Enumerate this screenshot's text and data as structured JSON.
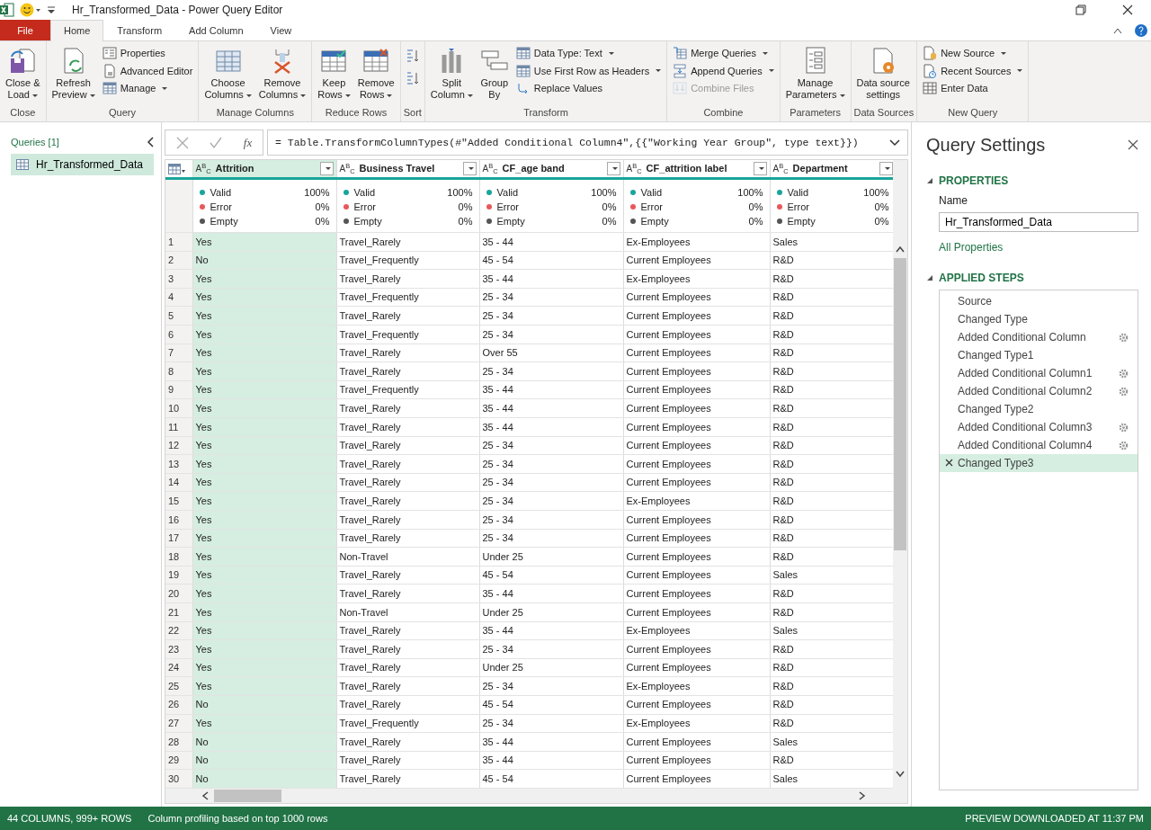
{
  "window": {
    "title": "Hr_Transformed_Data - Power Query Editor"
  },
  "tabs": [
    {
      "label": "File",
      "kind": "file",
      "selected": false
    },
    {
      "label": "Home",
      "kind": "tab",
      "selected": true
    },
    {
      "label": "Transform",
      "kind": "tab",
      "selected": false
    },
    {
      "label": "Add Column",
      "kind": "tab",
      "selected": false
    },
    {
      "label": "View",
      "kind": "tab",
      "selected": false
    }
  ],
  "ribbon": [
    {
      "label": "Close",
      "items": [
        {
          "kind": "large",
          "label": "Close &\nLoad",
          "dropdown": true,
          "disabled": false
        }
      ]
    },
    {
      "label": "Query",
      "items": [
        {
          "kind": "large",
          "label": "Refresh\nPreview",
          "dropdown": true,
          "disabled": false
        },
        {
          "kind": "small",
          "label": "Properties",
          "dropdown": false,
          "disabled": false
        },
        {
          "kind": "small",
          "label": "Advanced Editor",
          "dropdown": false,
          "disabled": false
        },
        {
          "kind": "small",
          "label": "Manage",
          "dropdown": true,
          "disabled": false
        }
      ]
    },
    {
      "label": "Manage Columns",
      "items": [
        {
          "kind": "large",
          "label": "Choose\nColumns",
          "dropdown": true,
          "disabled": false
        },
        {
          "kind": "large",
          "label": "Remove\nColumns",
          "dropdown": true,
          "disabled": false
        }
      ]
    },
    {
      "label": "Reduce Rows",
      "items": [
        {
          "kind": "large",
          "label": "Keep\nRows",
          "dropdown": true,
          "disabled": false
        },
        {
          "kind": "large",
          "label": "Remove\nRows",
          "dropdown": true,
          "disabled": false
        }
      ]
    },
    {
      "label": "Sort",
      "items": [
        {
          "kind": "icon",
          "dropdown": false,
          "disabled": false
        },
        {
          "kind": "icon",
          "dropdown": false,
          "disabled": false
        }
      ]
    },
    {
      "label": "Transform",
      "items": [
        {
          "kind": "large",
          "label": "Split\nColumn",
          "dropdown": true,
          "disabled": false
        },
        {
          "kind": "large",
          "label": "Group\nBy",
          "dropdown": false,
          "disabled": false
        },
        {
          "kind": "small",
          "label": "Data Type: Text",
          "dropdown": true,
          "disabled": false
        },
        {
          "kind": "small",
          "label": "Use First Row as Headers",
          "dropdown": true,
          "disabled": false
        },
        {
          "kind": "small",
          "label": "Replace Values",
          "dropdown": false,
          "disabled": false
        }
      ]
    },
    {
      "label": "Combine",
      "items": [
        {
          "kind": "small",
          "label": "Merge Queries",
          "dropdown": true,
          "disabled": false
        },
        {
          "kind": "small",
          "label": "Append Queries",
          "dropdown": true,
          "disabled": false
        },
        {
          "kind": "small",
          "label": "Combine Files",
          "dropdown": false,
          "disabled": true
        }
      ]
    },
    {
      "label": "Parameters",
      "items": [
        {
          "kind": "large",
          "label": "Manage\nParameters",
          "dropdown": true,
          "disabled": false
        }
      ]
    },
    {
      "label": "Data Sources",
      "items": [
        {
          "kind": "large",
          "label": "Data source\nsettings",
          "dropdown": false,
          "disabled": false
        }
      ]
    },
    {
      "label": "New Query",
      "items": [
        {
          "kind": "small",
          "label": "New Source",
          "dropdown": true,
          "disabled": false
        },
        {
          "kind": "small",
          "label": "Recent Sources",
          "dropdown": true,
          "disabled": false
        },
        {
          "kind": "small",
          "label": "Enter Data",
          "dropdown": false,
          "disabled": false
        }
      ]
    }
  ],
  "sidebar": {
    "title": "Queries [1]",
    "items": [
      {
        "label": "Hr_Transformed_Data",
        "selected": true
      }
    ]
  },
  "formula": {
    "function_label": "fx",
    "text": "= Table.TransformColumnTypes(#\"Added Conditional Column4\",{{\"Working Year Group\", type text}})"
  },
  "table": {
    "columns": [
      {
        "type": "A$^{B}$$_{C}$",
        "name": "Attrition",
        "selected": true,
        "profile": [
          {
            "label": "Valid",
            "value": "100%",
            "color": "#1aa59a"
          },
          {
            "label": "Error",
            "value": "0%",
            "color": "#e8585a"
          },
          {
            "label": "Empty",
            "value": "0%",
            "color": "#555555"
          }
        ]
      },
      {
        "type": "A$^{B}$$_{C}$",
        "name": "Business Travel",
        "selected": false,
        "profile": [
          {
            "label": "Valid",
            "value": "100%",
            "color": "#1aa59a"
          },
          {
            "label": "Error",
            "value": "0%",
            "color": "#e8585a"
          },
          {
            "label": "Empty",
            "value": "0%",
            "color": "#555555"
          }
        ]
      },
      {
        "type": "A$^{B}$$_{C}$",
        "name": "CF_age band",
        "selected": false,
        "profile": [
          {
            "label": "Valid",
            "value": "100%",
            "color": "#1aa59a"
          },
          {
            "label": "Error",
            "value": "0%",
            "color": "#e8585a"
          },
          {
            "label": "Empty",
            "value": "0%",
            "color": "#555555"
          }
        ]
      },
      {
        "type": "A$^{B}$$_{C}$",
        "name": "CF_attrition label",
        "selected": false,
        "profile": [
          {
            "label": "Valid",
            "value": "100%",
            "color": "#1aa59a"
          },
          {
            "label": "Error",
            "value": "0%",
            "color": "#e8585a"
          },
          {
            "label": "Empty",
            "value": "0%",
            "color": "#555555"
          }
        ]
      },
      {
        "type": "A$^{B}$$_{C}$",
        "name": "Department",
        "selected": false,
        "profile": [
          {
            "label": "Valid",
            "value": "100%",
            "color": "#1aa59a"
          },
          {
            "label": "Error",
            "value": "0%",
            "color": "#e8585a"
          },
          {
            "label": "Empty",
            "value": "0%",
            "color": "#555555"
          }
        ]
      }
    ],
    "rows": [
      {
        "number": "1",
        "cells": [
          "Yes",
          "Travel_Rarely",
          "35 - 44",
          "Ex-Employees",
          "Sales"
        ]
      },
      {
        "number": "2",
        "cells": [
          "No",
          "Travel_Frequently",
          "45 - 54",
          "Current Employees",
          "R&D"
        ]
      },
      {
        "number": "3",
        "cells": [
          "Yes",
          "Travel_Rarely",
          "35 - 44",
          "Ex-Employees",
          "R&D"
        ]
      },
      {
        "number": "4",
        "cells": [
          "Yes",
          "Travel_Frequently",
          "25 - 34",
          "Current Employees",
          "R&D"
        ]
      },
      {
        "number": "5",
        "cells": [
          "Yes",
          "Travel_Rarely",
          "25 - 34",
          "Current Employees",
          "R&D"
        ]
      },
      {
        "number": "6",
        "cells": [
          "Yes",
          "Travel_Frequently",
          "25 - 34",
          "Current Employees",
          "R&D"
        ]
      },
      {
        "number": "7",
        "cells": [
          "Yes",
          "Travel_Rarely",
          "Over 55",
          "Current Employees",
          "R&D"
        ]
      },
      {
        "number": "8",
        "cells": [
          "Yes",
          "Travel_Rarely",
          "25 - 34",
          "Current Employees",
          "R&D"
        ]
      },
      {
        "number": "9",
        "cells": [
          "Yes",
          "Travel_Frequently",
          "35 - 44",
          "Current Employees",
          "R&D"
        ]
      },
      {
        "number": "10",
        "cells": [
          "Yes",
          "Travel_Rarely",
          "35 - 44",
          "Current Employees",
          "R&D"
        ]
      },
      {
        "number": "11",
        "cells": [
          "Yes",
          "Travel_Rarely",
          "35 - 44",
          "Current Employees",
          "R&D"
        ]
      },
      {
        "number": "12",
        "cells": [
          "Yes",
          "Travel_Rarely",
          "25 - 34",
          "Current Employees",
          "R&D"
        ]
      },
      {
        "number": "13",
        "cells": [
          "Yes",
          "Travel_Rarely",
          "25 - 34",
          "Current Employees",
          "R&D"
        ]
      },
      {
        "number": "14",
        "cells": [
          "Yes",
          "Travel_Rarely",
          "25 - 34",
          "Current Employees",
          "R&D"
        ]
      },
      {
        "number": "15",
        "cells": [
          "Yes",
          "Travel_Rarely",
          "25 - 34",
          "Ex-Employees",
          "R&D"
        ]
      },
      {
        "number": "16",
        "cells": [
          "Yes",
          "Travel_Rarely",
          "25 - 34",
          "Current Employees",
          "R&D"
        ]
      },
      {
        "number": "17",
        "cells": [
          "Yes",
          "Travel_Rarely",
          "25 - 34",
          "Current Employees",
          "R&D"
        ]
      },
      {
        "number": "18",
        "cells": [
          "Yes",
          "Non-Travel",
          "Under 25",
          "Current Employees",
          "R&D"
        ]
      },
      {
        "number": "19",
        "cells": [
          "Yes",
          "Travel_Rarely",
          "45 - 54",
          "Current Employees",
          "Sales"
        ]
      },
      {
        "number": "20",
        "cells": [
          "Yes",
          "Travel_Rarely",
          "35 - 44",
          "Current Employees",
          "R&D"
        ]
      },
      {
        "number": "21",
        "cells": [
          "Yes",
          "Non-Travel",
          "Under 25",
          "Current Employees",
          "R&D"
        ]
      },
      {
        "number": "22",
        "cells": [
          "Yes",
          "Travel_Rarely",
          "35 - 44",
          "Ex-Employees",
          "Sales"
        ]
      },
      {
        "number": "23",
        "cells": [
          "Yes",
          "Travel_Rarely",
          "25 - 34",
          "Current Employees",
          "R&D"
        ]
      },
      {
        "number": "24",
        "cells": [
          "Yes",
          "Travel_Rarely",
          "Under 25",
          "Current Employees",
          "R&D"
        ]
      },
      {
        "number": "25",
        "cells": [
          "Yes",
          "Travel_Rarely",
          "25 - 34",
          "Ex-Employees",
          "R&D"
        ]
      },
      {
        "number": "26",
        "cells": [
          "No",
          "Travel_Rarely",
          "45 - 54",
          "Current Employees",
          "R&D"
        ]
      },
      {
        "number": "27",
        "cells": [
          "Yes",
          "Travel_Frequently",
          "25 - 34",
          "Ex-Employees",
          "R&D"
        ]
      },
      {
        "number": "28",
        "cells": [
          "No",
          "Travel_Rarely",
          "35 - 44",
          "Current Employees",
          "Sales"
        ]
      },
      {
        "number": "29",
        "cells": [
          "No",
          "Travel_Rarely",
          "35 - 44",
          "Current Employees",
          "R&D"
        ]
      },
      {
        "number": "30",
        "cells": [
          "No",
          "Travel_Rarely",
          "45 - 54",
          "Current Employees",
          "Sales"
        ]
      }
    ]
  },
  "settings": {
    "title": "Query Settings",
    "properties_heading": "PROPERTIES",
    "name_label": "Name",
    "name_value": "Hr_Transformed_Data",
    "all_properties": "All Properties",
    "steps_heading": "APPLIED STEPS",
    "steps": [
      {
        "label": "Source",
        "has_settings": false,
        "selected": false
      },
      {
        "label": "Changed Type",
        "has_settings": false,
        "selected": false
      },
      {
        "label": "Added Conditional Column",
        "has_settings": true,
        "selected": false
      },
      {
        "label": "Changed Type1",
        "has_settings": false,
        "selected": false
      },
      {
        "label": "Added Conditional Column1",
        "has_settings": true,
        "selected": false
      },
      {
        "label": "Added Conditional Column2",
        "has_settings": true,
        "selected": false
      },
      {
        "label": "Changed Type2",
        "has_settings": false,
        "selected": false
      },
      {
        "label": "Added Conditional Column3",
        "has_settings": true,
        "selected": false
      },
      {
        "label": "Added Conditional Column4",
        "has_settings": true,
        "selected": false
      },
      {
        "label": "Changed Type3",
        "has_settings": false,
        "selected": true
      }
    ]
  },
  "status_bar": {
    "left": [
      "44 COLUMNS, 999+ ROWS",
      "Column profiling based on top 1000 rows"
    ],
    "right": "PREVIEW DOWNLOADED AT 11:37 PM"
  }
}
